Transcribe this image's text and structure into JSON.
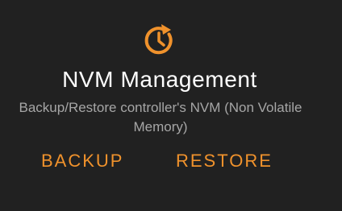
{
  "dialog": {
    "icon": "backup-restore-clock-icon",
    "title": "NVM Management",
    "description": "Backup/Restore controller's NVM (Non Volatile Memory)",
    "accent_color": "#f0922c",
    "background_color": "#212121"
  },
  "actions": {
    "backup_label": "BACKUP",
    "restore_label": "RESTORE"
  }
}
